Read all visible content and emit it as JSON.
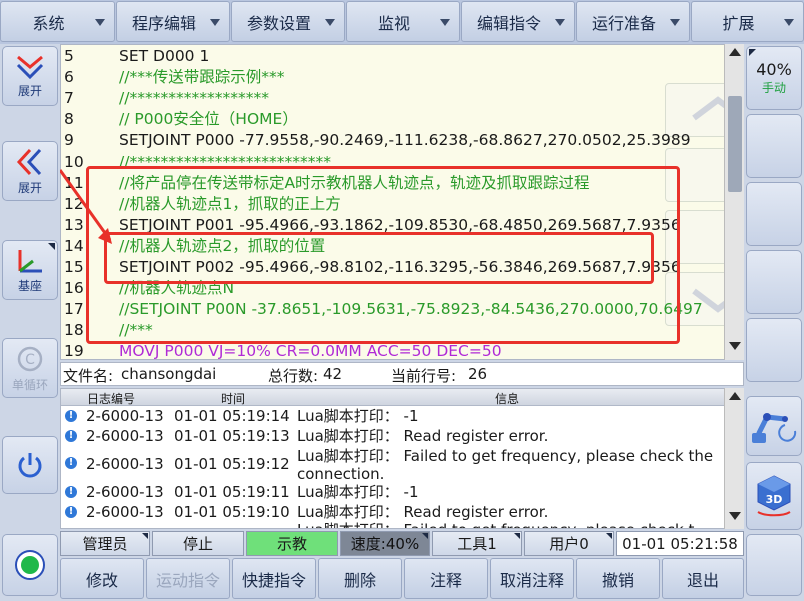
{
  "top_menu": [
    {
      "label": "系统"
    },
    {
      "label": "程序编辑"
    },
    {
      "label": "参数设置"
    },
    {
      "label": "监视"
    },
    {
      "label": "编辑指令"
    },
    {
      "label": "运行准备"
    },
    {
      "label": "扩展"
    }
  ],
  "left_sidebar": {
    "expand_label_1": "展开",
    "expand_label_2": "展开",
    "base_label": "基座",
    "single_cycle_label": "单循环"
  },
  "right_sidebar": {
    "speed_value": "40%",
    "mode_label": "手动"
  },
  "editor": {
    "lines": [
      {
        "no": "5",
        "text": "SET D000 1",
        "kind": "code"
      },
      {
        "no": "6",
        "text": "//***传送带跟踪示例***",
        "kind": "comment"
      },
      {
        "no": "7",
        "text": "//******************",
        "kind": "comment"
      },
      {
        "no": "8",
        "text": "// P000安全位（HOME）",
        "kind": "comment"
      },
      {
        "no": "9",
        "text": "SETJOINT P000 -77.9558,-90.2469,-111.6238,-68.8627,270.0502,25.3989",
        "kind": "code"
      },
      {
        "no": "10",
        "text": "//**************************",
        "kind": "comment"
      },
      {
        "no": "11",
        "text": "//将产品停在传送带标定A时示教机器人轨迹点，轨迹及抓取跟踪过程",
        "kind": "comment"
      },
      {
        "no": "12",
        "text": "//机器人轨迹点1，抓取的正上方",
        "kind": "comment"
      },
      {
        "no": "13",
        "text": "SETJOINT P001 -95.4966,-93.1862,-109.8530,-68.4850,269.5687,7.9356",
        "kind": "code"
      },
      {
        "no": "14",
        "text": "//机器人轨迹点2，抓取的位置",
        "kind": "comment"
      },
      {
        "no": "15",
        "text": "SETJOINT P002 -95.4966,-98.8102,-116.3295,-56.3846,269.5687,7.9356",
        "kind": "code"
      },
      {
        "no": "16",
        "text": "//机器人轨迹点N",
        "kind": "comment"
      },
      {
        "no": "17",
        "text": "//SETJOINT P00N -37.8651,-109.5631,-75.8923,-84.5436,270.0000,70.6497",
        "kind": "comment"
      },
      {
        "no": "18",
        "text": "//***",
        "kind": "comment"
      },
      {
        "no": "19",
        "text": "MOVJ P000 VJ=10% CR=0.0MM ACC=50 DEC=50",
        "kind": "motion"
      }
    ]
  },
  "file_info": {
    "filename_label": "文件名:",
    "filename": "chansongdai",
    "total_lines_label": "总行数:",
    "total_lines": "42",
    "current_line_label": "当前行号:",
    "current_line": "26"
  },
  "log": {
    "headers": {
      "code": "日志编号",
      "time": "时间",
      "info": "信息"
    },
    "rows": [
      {
        "code": "2-6000-13",
        "time": "01-01 05:19:14",
        "msg": "Lua脚本打印： -1"
      },
      {
        "code": "2-6000-13",
        "time": "01-01 05:19:13",
        "msg": "Lua脚本打印： Read register error."
      },
      {
        "code": "2-6000-13",
        "time": "01-01 05:19:12",
        "msg": "Lua脚本打印： Failed to get frequency, please check the connection."
      },
      {
        "code": "2-6000-13",
        "time": "01-01 05:19:11",
        "msg": "Lua脚本打印： -1"
      },
      {
        "code": "2-6000-13",
        "time": "01-01 05:19:10",
        "msg": "Lua脚本打印： Read register error."
      },
      {
        "code": "",
        "time": "",
        "msg": "Lua脚本打印： Failed to get frequency, please check t"
      }
    ]
  },
  "status_bar": {
    "user_role": "管理员",
    "run_state": "停止",
    "mode": "示教",
    "speed": "速度:40%",
    "tool": "工具1",
    "user_frame": "用户0",
    "datetime": "01-01 05:21:58"
  },
  "bottom_actions": [
    {
      "label": "修改"
    },
    {
      "label": "运动指令"
    },
    {
      "label": "快捷指令"
    },
    {
      "label": "删除"
    },
    {
      "label": "注释"
    },
    {
      "label": "取消注释"
    },
    {
      "label": "撤销"
    },
    {
      "label": "退出"
    }
  ],
  "colors": {
    "comment": "#2a9a2a",
    "motion": "#b02ad6",
    "highlight_box": "#e8312a",
    "teach_mode_bg": "#6fe07a",
    "speed_bg": "#7e8796"
  }
}
